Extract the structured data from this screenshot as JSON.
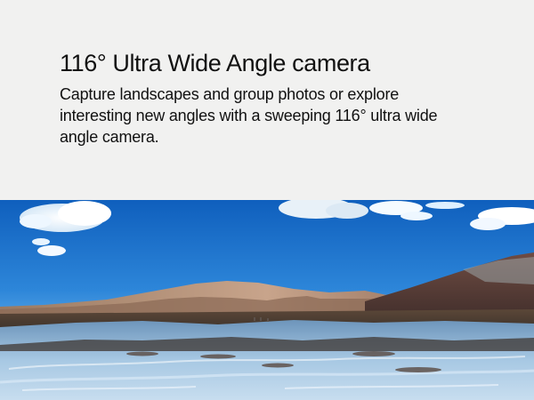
{
  "headline": "116° Ultra Wide Angle camera",
  "body": "Capture landscapes and group photos or explore interesting new angles with a sweeping 116° ultra wide angle camera.",
  "colors": {
    "background": "#f1f1f0",
    "text": "#111111",
    "sky_top": "#1266c7",
    "sky_bottom": "#8ec9f2",
    "water": "#9fc3df",
    "ground": "#5a4535"
  }
}
